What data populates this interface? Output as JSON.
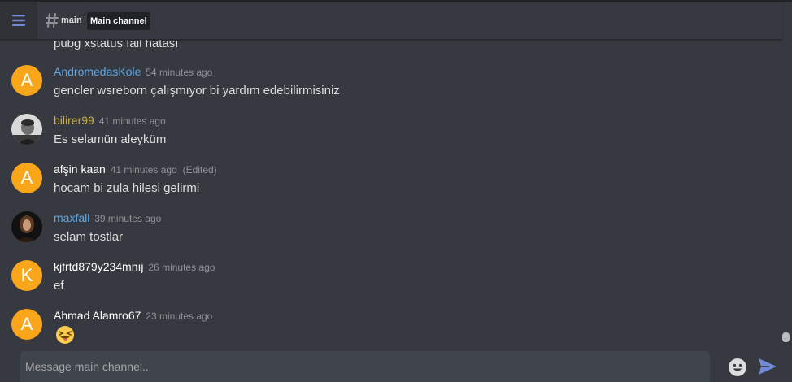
{
  "header": {
    "menu_icon": "hamburger-menu-icon",
    "channel_icon": "hash-icon",
    "channel_name": "main",
    "channel_topic": "Main channel"
  },
  "messages": {
    "partial": {
      "text": "pubg xstatus fail hatası"
    },
    "items": [
      {
        "avatar": "A",
        "author": "AndromedasKole",
        "author_color": "#5fa8e8",
        "time": "54 minutes ago",
        "edited": "",
        "text": "gencler wsreborn çalışmıyor bi yardım edebilirmisiniz"
      },
      {
        "avatar": "",
        "author": "bilirer99",
        "author_color": "#c9b045",
        "time": "41 minutes ago",
        "edited": "",
        "text": "Es selamün aleyküm"
      },
      {
        "avatar": "A",
        "author": "afşin kaan",
        "author_color": "#ffffff",
        "time": "41 minutes ago",
        "edited": "(Edited)",
        "text": "hocam bi zula hilesi gelirmi"
      },
      {
        "avatar": "",
        "author": "maxfall",
        "author_color": "#5fa8e8",
        "time": "39 minutes ago",
        "edited": "",
        "text": "selam tostlar"
      },
      {
        "avatar": "K",
        "author": "kjfrtd879y234mnıj",
        "author_color": "#ffffff",
        "time": "26 minutes ago",
        "edited": "",
        "text": "ef"
      },
      {
        "avatar": "A",
        "author": "Ahmad Alamro67",
        "author_color": "#ffffff",
        "time": "23 minutes ago",
        "edited": "",
        "text": "",
        "emoji": "squinting-face-with-tongue-emoji"
      }
    ]
  },
  "composer": {
    "placeholder": "Message main channel..",
    "emoji_icon": "smiley-icon",
    "send_icon": "send-arrow-icon"
  }
}
